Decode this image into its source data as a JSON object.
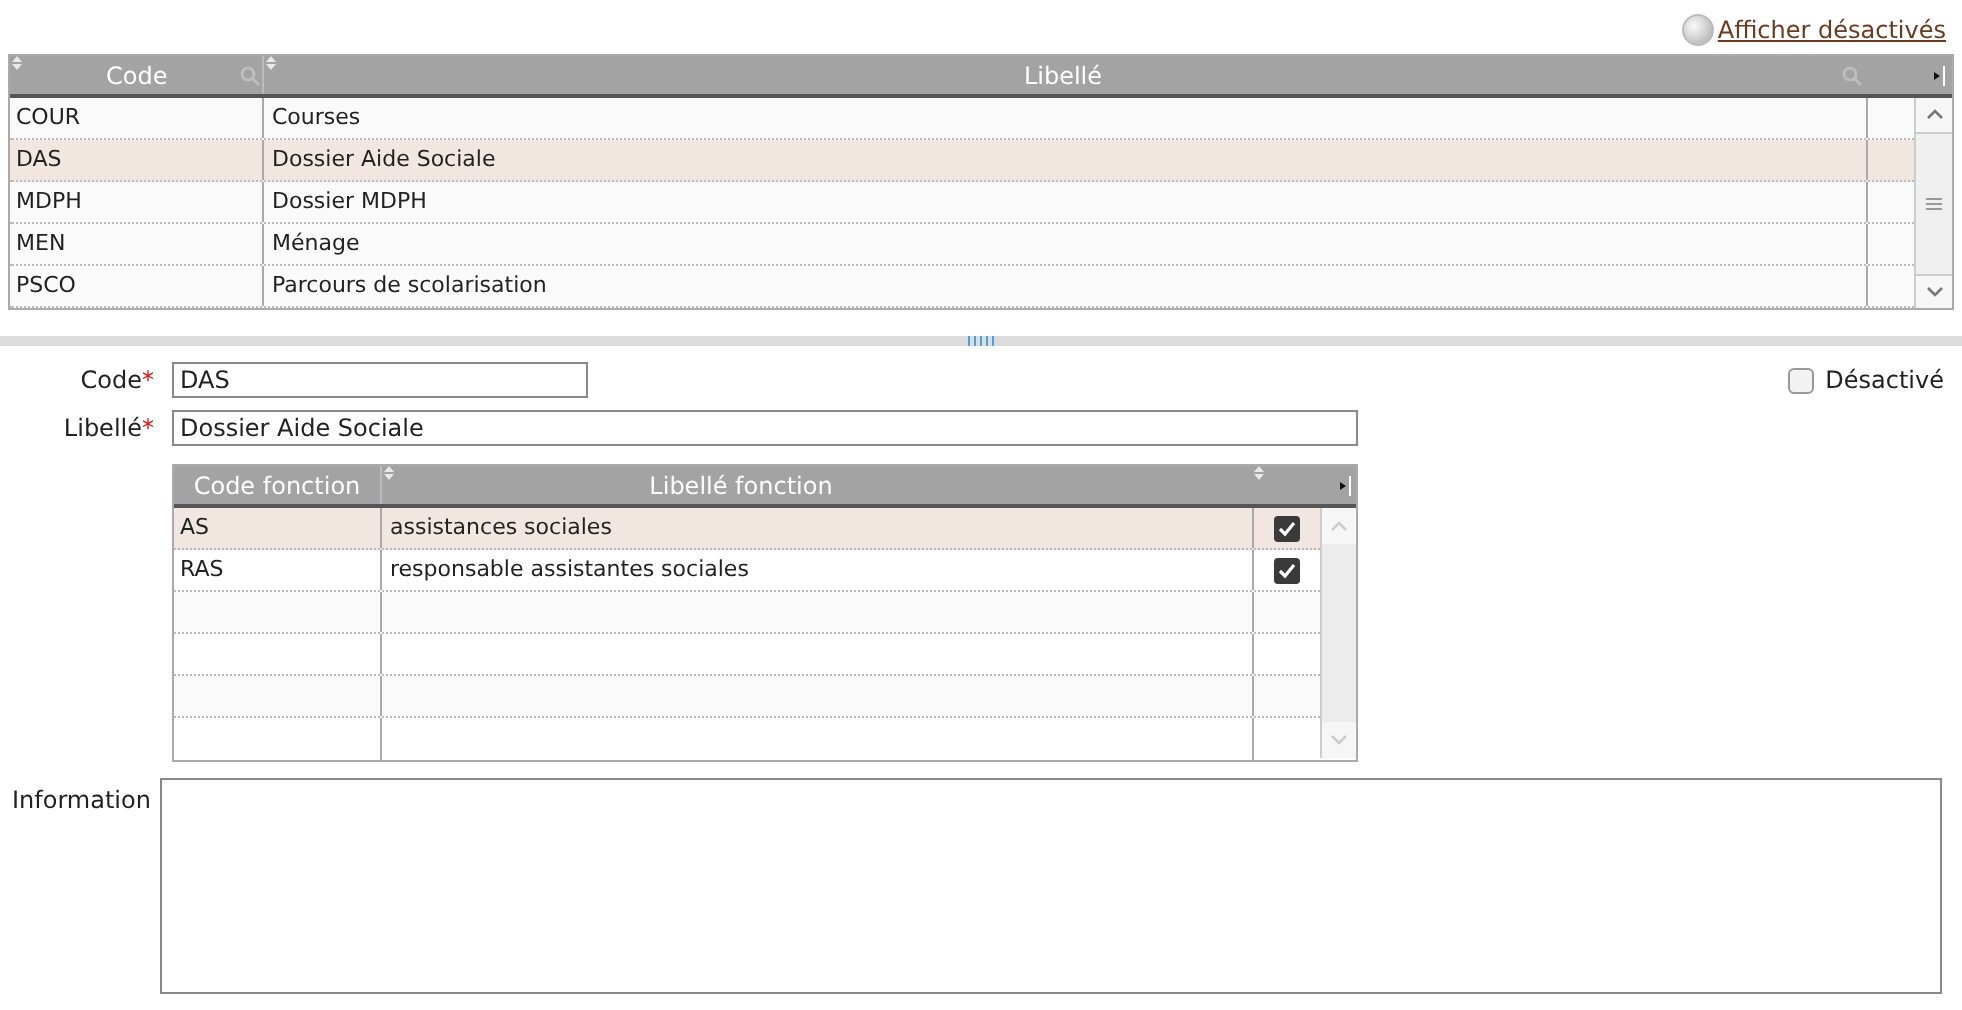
{
  "show_disabled_link": "Afficher désactivés",
  "list": {
    "columns": [
      "Code",
      "Libellé"
    ],
    "rows": [
      {
        "code": "COUR",
        "label": "Courses",
        "selected": false
      },
      {
        "code": "DAS",
        "label": "Dossier Aide Sociale",
        "selected": true
      },
      {
        "code": "MDPH",
        "label": "Dossier MDPH",
        "selected": false
      },
      {
        "code": "MEN",
        "label": "Ménage",
        "selected": false
      },
      {
        "code": "PSCO",
        "label": "Parcours de scolarisation",
        "selected": false
      }
    ]
  },
  "form": {
    "code": {
      "label": "Code",
      "required_mark": "*",
      "value": "DAS"
    },
    "libelle": {
      "label": "Libellé",
      "required_mark": "*",
      "value": "Dossier Aide Sociale"
    },
    "disabled": {
      "label": "Désactivé",
      "checked": false
    },
    "functions": {
      "columns": [
        "Code fonction",
        "Libellé fonction"
      ],
      "rows": [
        {
          "code": "AS",
          "label": "assistances sociales",
          "checked": true,
          "selected": true
        },
        {
          "code": "RAS",
          "label": "responsable assistantes sociales",
          "checked": true,
          "selected": false
        }
      ]
    },
    "information": {
      "label": "Information"
    }
  }
}
